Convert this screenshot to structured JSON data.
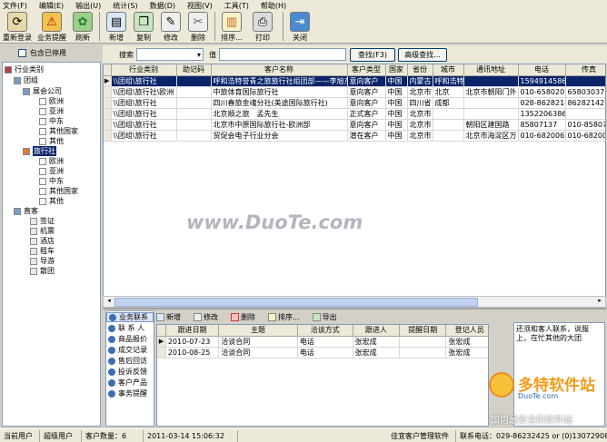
{
  "menu": [
    "文件(F)",
    "编辑(E)",
    "输出(U)",
    "统计(S)",
    "数据(D)",
    "视图(V)",
    "工具(T)",
    "帮助(H)"
  ],
  "toolbar": {
    "relogin": "重新登录",
    "reminder": "业务提醒",
    "refresh": "刷新",
    "new": "新增",
    "copy": "复制",
    "edit": "修改",
    "delete": "删除",
    "sort": "排序...",
    "print": "打印",
    "close": "关闭"
  },
  "filter": {
    "show_disabled": "包含已停用",
    "search_label": "搜索",
    "value_label": "值",
    "find_btn": "查找(F3)",
    "advanced_btn": "高级查找..."
  },
  "tree": {
    "root": "行业类别",
    "nodes": [
      "团组",
      "展会公司",
      "欧洲",
      "亚洲",
      "中东",
      "其他国家",
      "其他",
      "旅行社",
      "欧洲",
      "亚洲",
      "中东",
      "其他国家",
      "其他",
      "直客",
      "签证",
      "机票",
      "酒店",
      "租车",
      "导游",
      "散团"
    ]
  },
  "grid": {
    "columns": [
      "行业类别",
      "助记码",
      "客户名称",
      "客户类型",
      "国家",
      "省份",
      "城市",
      "通讯地址",
      "电话",
      "传真"
    ],
    "rows": [
      [
        "\\\\团组\\旅行社",
        "",
        "呼和浩特誉青之旅旅行社组团部——李旭东",
        "意向客户",
        "中国",
        "内蒙古",
        "呼和浩特",
        "",
        "15949145868",
        ""
      ],
      [
        "\\\\团组\\旅行社\\欧洲",
        "",
        "中旅体育国际旅行社",
        "意向客户",
        "中国",
        "北京市",
        "北京",
        "北京市朝阳门外",
        "010-65802015",
        "65803037"
      ],
      [
        "\\\\团组\\旅行社",
        "",
        "四川春旅金魂分社(美途国际旅行社)",
        "意向客户",
        "中国",
        "四川省",
        "成都",
        "",
        "028-86282142",
        "86282142"
      ],
      [
        "\\\\团组\\旅行社",
        "",
        "北京顺之旅　孟先生",
        "正式客户",
        "中国",
        "北京市",
        "",
        "",
        "13522063866",
        ""
      ],
      [
        "\\\\团组\\旅行社",
        "",
        "北京市中原国际旅行社-欧洲部",
        "意向客户",
        "中国",
        "北京市",
        "",
        "朝阳区建国路",
        "85807137",
        "010-85807"
      ],
      [
        "\\\\团组\\旅行社",
        "",
        "贸促会电子行业分会",
        "潜在客户",
        "中国",
        "北京市",
        "",
        "北京市海淀区万",
        "010-68200628",
        "010-68200"
      ]
    ]
  },
  "left_panel": [
    "业务联系",
    "联 系 人",
    "商品报价",
    "成交记录",
    "售后回访",
    "投诉反馈",
    "客户产品",
    "事务提醒"
  ],
  "subbar": {
    "new": "新增",
    "edit": "修改",
    "delete": "删除",
    "sort": "排序...",
    "export": "导出"
  },
  "subgrid": {
    "columns": [
      "跟进日期",
      "主题",
      "洽谈方式",
      "跟进人",
      "提醒日期",
      "登记人员"
    ],
    "rows": [
      [
        "2010-07-23",
        "洽谈合同",
        "电话",
        "张宏成",
        "",
        "张宏成"
      ],
      [
        "2010-08-25",
        "洽谈合同",
        "电话",
        "张宏成",
        "",
        "张宏成"
      ]
    ]
  },
  "note": "还须和客人联系，说服上，在忙其他的大团",
  "status": {
    "current_user_label": "当前用户",
    "current_user": "超级用户",
    "customer_count": "客户数量：6",
    "datetime": "2011-03-14 15:06:32",
    "software": "佳宜客户管理软件",
    "phone": "联系电话：029-86232425 or (0)13072908445"
  },
  "watermark": {
    "center": "www.DuoTe.com",
    "brand": "多特软件站",
    "domain": "DuoTe.com",
    "slogan": "国内最安全的软件站"
  }
}
